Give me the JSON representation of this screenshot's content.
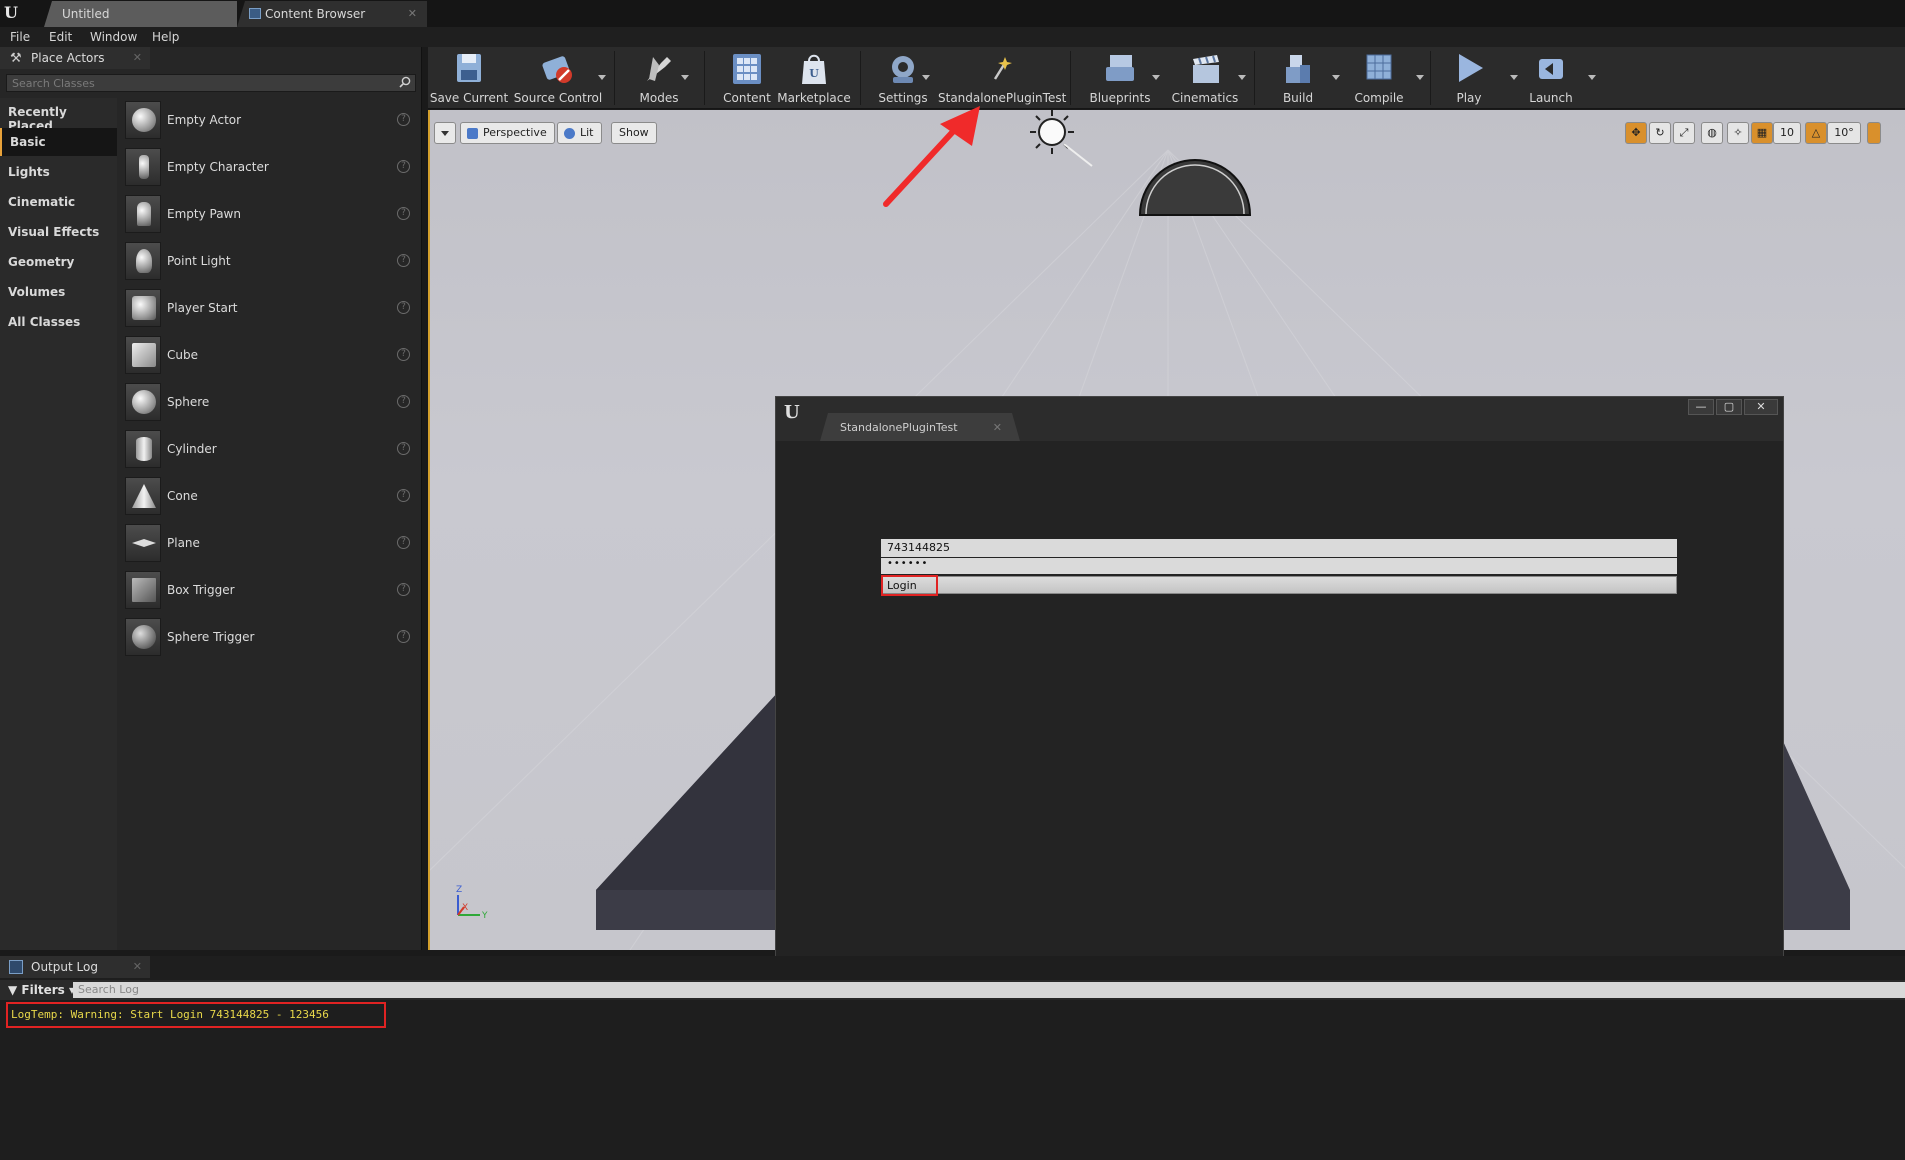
{
  "tabs": {
    "untitled": "Untitled",
    "content_browser": "Content Browser"
  },
  "menu": [
    "File",
    "Edit",
    "Window",
    "Help"
  ],
  "place_actors": {
    "title": "Place Actors",
    "search_placeholder": "Search Classes",
    "categories": [
      "Recently Placed",
      "Basic",
      "Lights",
      "Cinematic",
      "Visual Effects",
      "Geometry",
      "Volumes",
      "All Classes"
    ],
    "active_category": "Basic",
    "items": [
      "Empty Actor",
      "Empty Character",
      "Empty Pawn",
      "Point Light",
      "Player Start",
      "Cube",
      "Sphere",
      "Cylinder",
      "Cone",
      "Plane",
      "Box Trigger",
      "Sphere Trigger"
    ]
  },
  "toolbar": {
    "items": [
      "Save Current",
      "Source Control",
      "Modes",
      "Content",
      "Marketplace",
      "Settings",
      "StandalonePluginTest",
      "Blueprints",
      "Cinematics",
      "Build",
      "Compile",
      "Play",
      "Launch"
    ]
  },
  "viewport": {
    "perspective": "Perspective",
    "lit": "Lit",
    "show": "Show",
    "grid_snap": "10",
    "rotation_snap": "10°"
  },
  "standalone": {
    "tab_title": "StandalonePluginTest",
    "username": "743144825",
    "password_masked": "••••••",
    "login_label": "Login"
  },
  "output_log": {
    "title": "Output Log",
    "filters": "Filters",
    "search_placeholder": "Search Log",
    "line": "LogTemp: Warning: Start Login 743144825 - 123456"
  },
  "colors": {
    "accent_orange": "#d4a02c",
    "highlight_red": "#e02323",
    "log_warning": "#e8d84a"
  }
}
